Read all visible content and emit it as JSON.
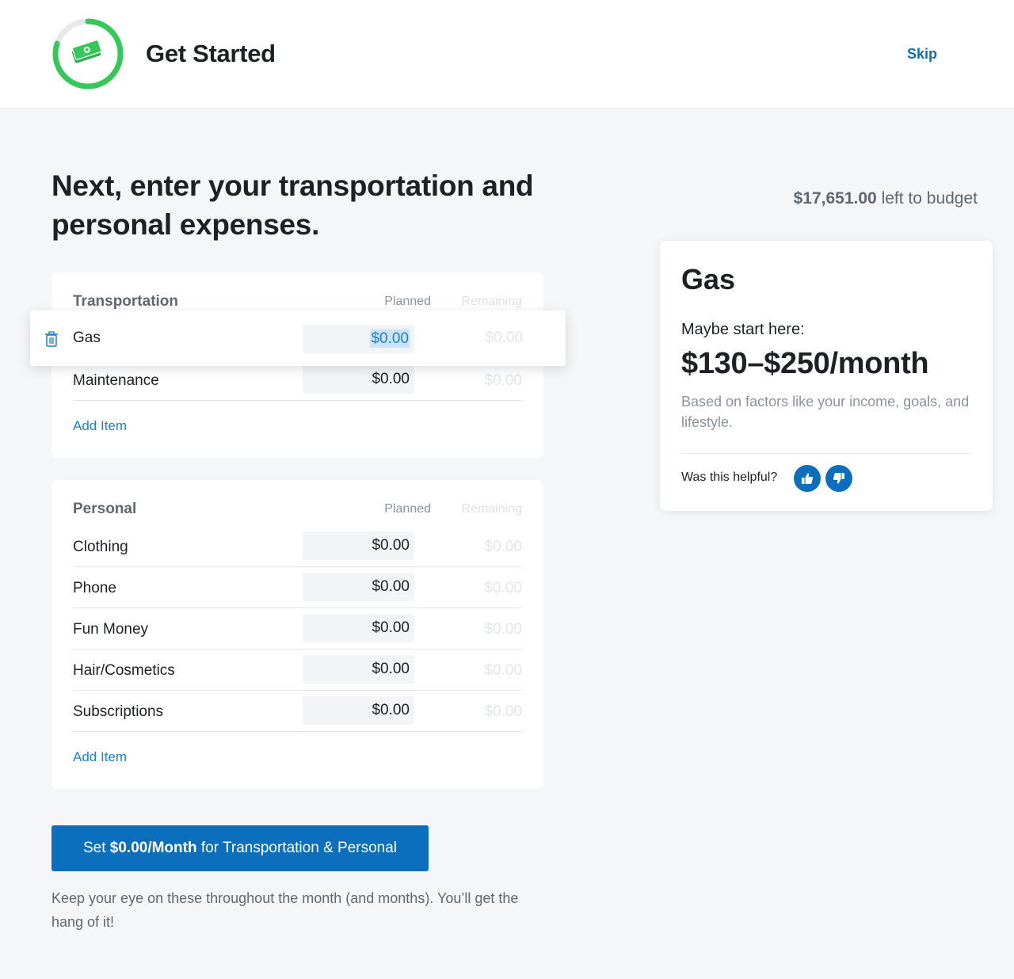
{
  "header": {
    "title": "Get Started",
    "skip_label": "Skip",
    "progress": 0.8,
    "progress_color": "#34c759"
  },
  "page": {
    "heading": "Next, enter your transportation and personal expenses."
  },
  "budget": {
    "amount": "$17,651.00",
    "suffix": "left to budget"
  },
  "columns": {
    "planned": "Planned",
    "remaining": "Remaining"
  },
  "transportation": {
    "title": "Transportation",
    "items": [
      {
        "label": "Gas",
        "planned": "$0.00",
        "remaining": "$0.00",
        "active": true
      },
      {
        "label": "Maintenance",
        "planned": "$0.00",
        "remaining": "$0.00"
      }
    ],
    "add_item": "Add Item"
  },
  "personal": {
    "title": "Personal",
    "items": [
      {
        "label": "Clothing",
        "planned": "$0.00",
        "remaining": "$0.00"
      },
      {
        "label": "Phone",
        "planned": "$0.00",
        "remaining": "$0.00"
      },
      {
        "label": "Fun Money",
        "planned": "$0.00",
        "remaining": "$0.00"
      },
      {
        "label": "Hair/Cosmetics",
        "planned": "$0.00",
        "remaining": "$0.00"
      },
      {
        "label": "Subscriptions",
        "planned": "$0.00",
        "remaining": "$0.00"
      }
    ],
    "add_item": "Add Item"
  },
  "tip": {
    "title": "Gas",
    "maybe": "Maybe start here:",
    "range": "$130–$250/month",
    "note": "Based on factors like your income, goals, and lifestyle.",
    "helpful": "Was this helpful?"
  },
  "cta": {
    "prefix": "Set",
    "amount": "$0.00/Month",
    "suffix": "for Transportation & Personal"
  },
  "footnote": "Keep your eye on these throughout the month (and months). You’ll get the hang of it!",
  "colors": {
    "brand_blue": "#0b6fbd",
    "link_blue": "#1a83cf",
    "green": "#34c759"
  },
  "icons": [
    "money-icon",
    "trash-icon",
    "thumbs-up-icon",
    "thumbs-down-icon"
  ]
}
